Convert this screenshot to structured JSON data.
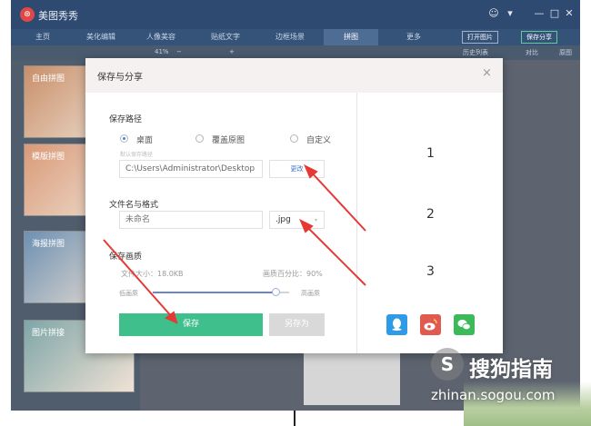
{
  "app": {
    "logo_glyph": "⊛",
    "title": "美图秀秀",
    "controls": [
      "☺",
      "▾",
      "—",
      "□",
      "✕"
    ]
  },
  "tabs": [
    "主页",
    "美化编辑",
    "人像美容",
    "贴纸文字",
    "边框场景",
    "拼图",
    "更多"
  ],
  "active_tab": "拼图",
  "header_buttons": {
    "open": "打开图片",
    "save": "保存分享"
  },
  "toolbar": {
    "zoom": "41%",
    "zoom_out": "−",
    "zoom_in": "+",
    "history": "历史列表",
    "compare": "对比",
    "original": "原图"
  },
  "left_panel": {
    "cards": [
      {
        "label": "自由拼图",
        "color": "#c88f6a"
      },
      {
        "label": "模版拼图",
        "color": "#d99a78"
      },
      {
        "label": "海报拼图",
        "color": "#6d90b3"
      },
      {
        "label": "图片拼接",
        "color": "#7ea6a8"
      }
    ]
  },
  "dialog": {
    "title": "保存与分享",
    "close": "×",
    "path": {
      "title": "保存路径",
      "options": [
        "桌面",
        "覆盖原图",
        "自定义"
      ],
      "selected": "桌面",
      "hint": "默认保存路径",
      "value": "C:\\Users\\Administrator\\Desktop",
      "change_button": "更改"
    },
    "file": {
      "title": "文件名与格式",
      "name_placeholder": "未命名",
      "format": ".jpg",
      "format_arrow": "▾"
    },
    "quality": {
      "title": "保存画质",
      "size_text": "文件大小：18.0KB",
      "percent_text": "画质百分比：90%",
      "level": 0.9,
      "low_label": "低画质",
      "high_label": "高画质"
    },
    "save_button": "保存",
    "save_as_button": "另存为"
  },
  "annotations": {
    "numbers": [
      "1",
      "2",
      "3"
    ]
  },
  "share_icons": [
    {
      "name": "qq-icon",
      "color": "#2f9be6"
    },
    {
      "name": "weibo-icon",
      "color": "#e05a4f"
    },
    {
      "name": "wechat-icon",
      "color": "#3cba5a"
    }
  ],
  "watermark": {
    "logo": "S",
    "text": "搜狗指南",
    "url": "zhinan.sogou.com"
  },
  "colors": {
    "accent_green": "#3fbf8c",
    "arrow_red": "#e53935"
  }
}
